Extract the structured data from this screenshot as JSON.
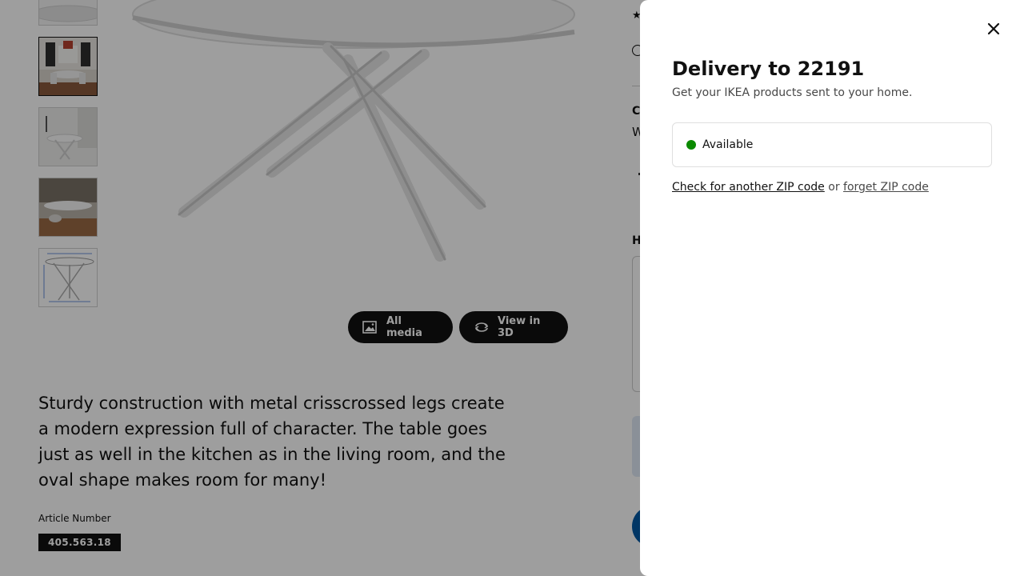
{
  "product": {
    "description": "Sturdy construction with metal crisscrossed legs create a modern expression full of character. The table goes just as well in the kitchen as in the living room, and the oval shape makes room for many!",
    "article_label": "Article Number",
    "article_number": "405.563.18",
    "all_media_label": "All media",
    "view_3d_label": "View in 3D",
    "right_column": {
      "heading_c": "C",
      "text_w": "W",
      "heading_h": "H"
    },
    "thumbnails": [
      {
        "name": "thumbnail-table-top"
      },
      {
        "name": "thumbnail-dining-room-scene"
      },
      {
        "name": "thumbnail-kitchen-scene"
      },
      {
        "name": "thumbnail-living-room-scene"
      },
      {
        "name": "thumbnail-dimensions-drawing"
      }
    ]
  },
  "delivery_sheet": {
    "title": "Delivery to 22191",
    "subtitle": "Get your IKEA products sent to your home.",
    "status": "Available",
    "status_color": "#0a8a00",
    "check_link": "Check for another ZIP code",
    "or_text": " or ",
    "forget_link": "forget ZIP code",
    "close_icon": "close-icon"
  },
  "colors": {
    "overlay": "rgba(0,0,0,0.38)",
    "accent_blue": "#0058a3",
    "dark": "#111111"
  }
}
